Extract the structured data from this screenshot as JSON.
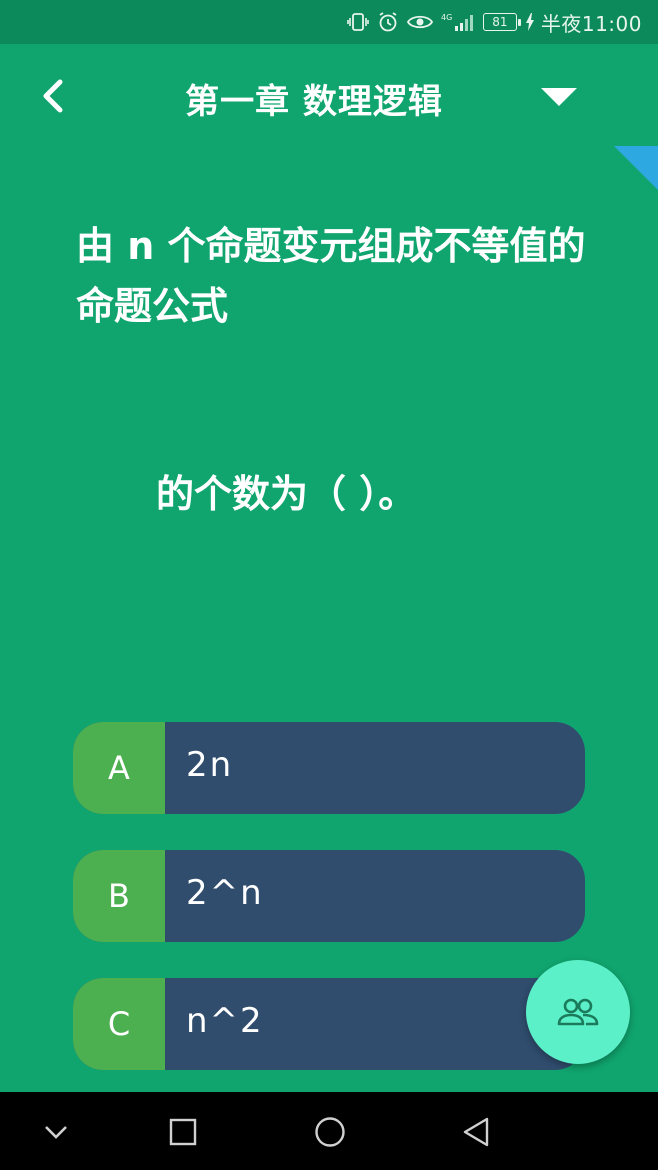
{
  "status_bar": {
    "battery": "81",
    "time": "半夜11:00",
    "network": "4G"
  },
  "header": {
    "title": "第一章 数理逻辑"
  },
  "question": {
    "line1": "由 n 个命题变元组成不等值的命题公式",
    "line2": "的个数为（   ）。"
  },
  "options": [
    {
      "letter": "A",
      "text": "2n"
    },
    {
      "letter": "B",
      "text": "2^n"
    },
    {
      "letter": "C",
      "text": "n^2"
    }
  ],
  "colors": {
    "background": "#10a56f",
    "status_bar": "#0c8a5c",
    "option_letter_bg": "#4caf50",
    "option_text_bg": "#304d6e",
    "fab": "#5cf0c8",
    "corner_accent": "#2ea8e0"
  },
  "icons": {
    "back": "chevron-left-icon",
    "dropdown": "triangle-down-icon",
    "fab": "people-icon",
    "nav": [
      "chevron-down-icon",
      "square-icon",
      "circle-icon",
      "triangle-back-icon"
    ]
  }
}
